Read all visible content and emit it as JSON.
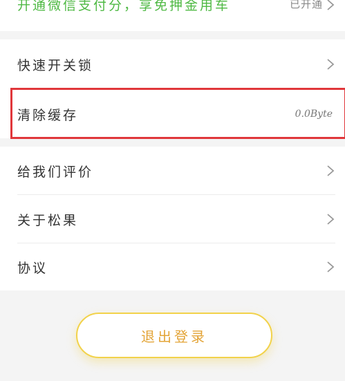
{
  "banner": {
    "text": "开通微信支付分，享免押金用车",
    "status": "已开通"
  },
  "menu_group1": [
    {
      "label": "快速开关锁",
      "value": ""
    },
    {
      "label": "清除缓存",
      "value": "0.0Byte"
    }
  ],
  "menu_group2": [
    {
      "label": "给我们评价"
    },
    {
      "label": "关于松果"
    },
    {
      "label": "协议"
    }
  ],
  "logout": {
    "label": "退出登录"
  },
  "colors": {
    "accent_green": "#4fb944",
    "highlight_red": "#e0373b",
    "logout_border": "#f2d24a",
    "logout_text": "#e3a437"
  }
}
